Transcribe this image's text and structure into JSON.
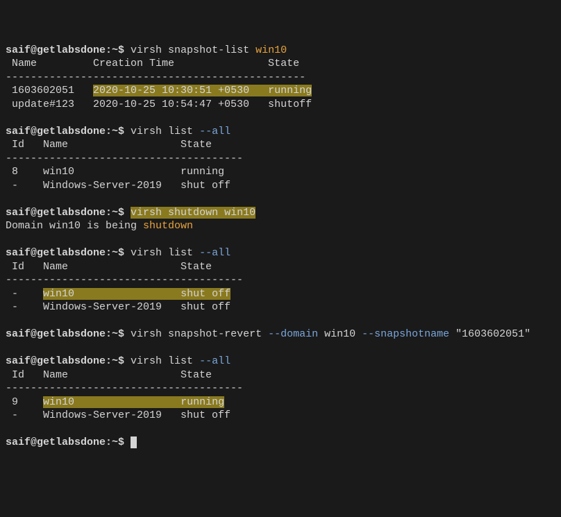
{
  "prompt": "saif@getlabsdone:~$",
  "cmd1": {
    "command": "virsh snapshot-list",
    "arg": "win10"
  },
  "snap_header": " Name         Creation Time               State",
  "dashes_snap": "------------------------------------------------",
  "snap_row1": {
    "name": " 1603602051   ",
    "highlight": "2020-10-25 10:30:51 +0530   running",
    "tail": ""
  },
  "snap_row2": " update#123   2020-10-25 10:54:47 +0530   shutoff",
  "cmd2": {
    "command": "virsh list ",
    "flag": "--all"
  },
  "list_header": " Id   Name                  State",
  "dashes_list": "--------------------------------------",
  "list2_row1": " 8    win10                 running",
  "list2_row2": " -    Windows-Server-2019   shut off",
  "cmd3": {
    "highlight": "virsh shutdown win10"
  },
  "shutdown_msg": {
    "pre": "Domain win10 is being ",
    "word": "shutdown"
  },
  "cmd4": {
    "command": "virsh list ",
    "flag": "--all"
  },
  "list4_row1": {
    "pre": " -    ",
    "hl1": "win10                 ",
    "hl2": "shut off"
  },
  "list4_row2": " -    Windows-Server-2019   shut off",
  "cmd5": {
    "command": "virsh snapshot-revert ",
    "flag1": "--domain",
    "mid": " win10 ",
    "flag2": "--snapshotname",
    "tail": " \"1603602051\""
  },
  "cmd6": {
    "command": "virsh list ",
    "flag": "--all"
  },
  "list6_row1": {
    "pre": " 9    ",
    "hl1": "win10                 ",
    "hl2": "running"
  },
  "list6_row2": " -    Windows-Server-2019   shut off"
}
